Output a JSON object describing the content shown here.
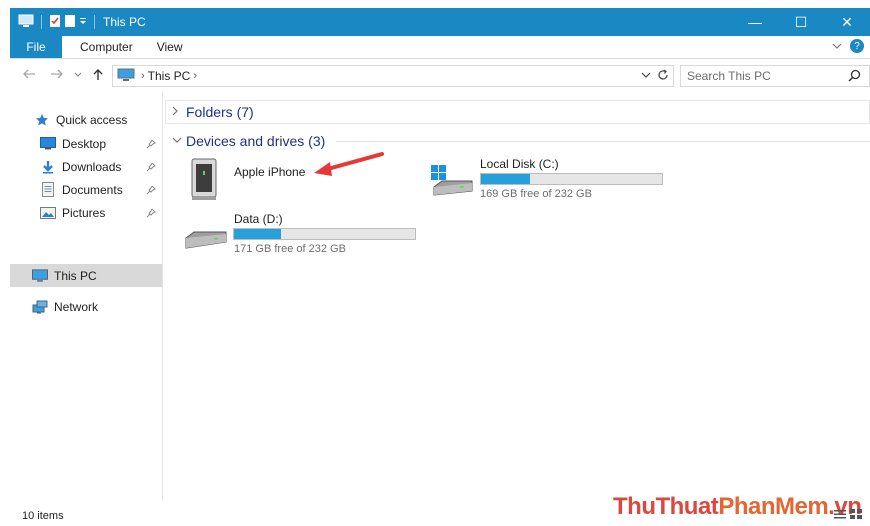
{
  "window": {
    "title": "This PC",
    "controls": {
      "minimize": "—",
      "maximize": "☐",
      "close": "✕"
    }
  },
  "ribbon": {
    "tabs": [
      {
        "label": "File"
      },
      {
        "label": "Computer"
      },
      {
        "label": "View"
      }
    ]
  },
  "address": {
    "crumbs": [
      "This PC"
    ],
    "search_placeholder": "Search This PC"
  },
  "navpane": {
    "items": [
      {
        "label": "Quick access"
      },
      {
        "label": "Desktop"
      },
      {
        "label": "Downloads"
      },
      {
        "label": "Documents"
      },
      {
        "label": "Pictures"
      },
      {
        "label": "This PC"
      },
      {
        "label": "Network"
      }
    ]
  },
  "content": {
    "folders_group": "Folders (7)",
    "devices_group": "Devices and drives (3)",
    "drives": [
      {
        "name": "Apple iPhone"
      },
      {
        "name": "Local Disk (C:)",
        "free_text": "169 GB free of 232 GB",
        "used_fraction": 0.27
      },
      {
        "name": "Data (D:)",
        "free_text": "171 GB free of 232 GB",
        "used_fraction": 0.26
      }
    ]
  },
  "status": {
    "items_text": "10 items"
  },
  "watermark": {
    "part1": "ThuThuat",
    "part2": "PhanMem",
    "part3": ".vn"
  },
  "colors": {
    "titlebar": "#1a88c2",
    "accent": "#26a0da",
    "group_header": "#1e3287",
    "arrow": "#e53935"
  }
}
